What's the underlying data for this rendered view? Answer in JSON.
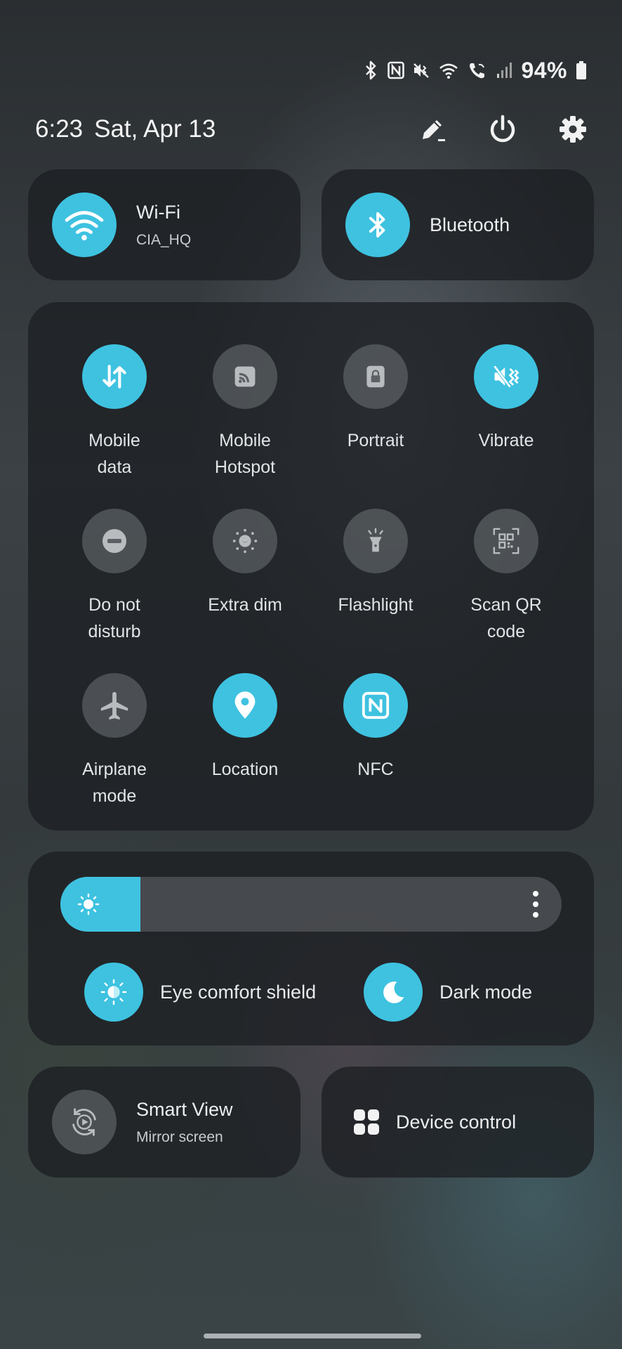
{
  "status_bar": {
    "icons": [
      "bluetooth-icon",
      "nfc-icon",
      "vibrate-icon",
      "wifi-icon",
      "wifi-calling-icon",
      "signal-icon",
      "battery-icon"
    ],
    "battery_percent": "94%"
  },
  "header": {
    "time": "6:23",
    "date": "Sat, Apr 13",
    "actions": [
      "edit-icon",
      "power-icon",
      "settings-icon"
    ]
  },
  "wifi_tile": {
    "title": "Wi-Fi",
    "subtitle": "CIA_HQ",
    "state": "on"
  },
  "bluetooth_tile": {
    "title": "Bluetooth",
    "state": "on"
  },
  "quick_tiles": [
    {
      "label": "Mobile\ndata",
      "icon": "mobile-data-icon",
      "state": "on"
    },
    {
      "label": "Mobile\nHotspot",
      "icon": "hotspot-icon",
      "state": "off"
    },
    {
      "label": "Portrait",
      "icon": "portrait-lock-icon",
      "state": "off"
    },
    {
      "label": "Vibrate",
      "icon": "vibrate-icon",
      "state": "on"
    },
    {
      "label": "Do not\ndisturb",
      "icon": "do-not-disturb-icon",
      "state": "off"
    },
    {
      "label": "Extra dim",
      "icon": "extra-dim-icon",
      "state": "off"
    },
    {
      "label": "Flashlight",
      "icon": "flashlight-icon",
      "state": "off"
    },
    {
      "label": "Scan QR\ncode",
      "icon": "qr-scan-icon",
      "state": "off"
    },
    {
      "label": "Airplane\nmode",
      "icon": "airplane-icon",
      "state": "off"
    },
    {
      "label": "Location",
      "icon": "location-icon",
      "state": "on"
    },
    {
      "label": "NFC",
      "icon": "nfc-icon",
      "state": "on"
    }
  ],
  "brightness": {
    "level": 0.16,
    "icon": "sun-icon",
    "more": "more-vertical-icon"
  },
  "eye_comfort": {
    "label": "Eye comfort shield",
    "state": "on"
  },
  "dark_mode": {
    "label": "Dark mode",
    "state": "on"
  },
  "smart_view": {
    "title": "Smart View",
    "subtitle": "Mirror screen"
  },
  "device_control": {
    "title": "Device control"
  },
  "colors": {
    "accent": "#3ec2e0",
    "panel": "#1c1f22",
    "off_circle": "#6e7276"
  }
}
